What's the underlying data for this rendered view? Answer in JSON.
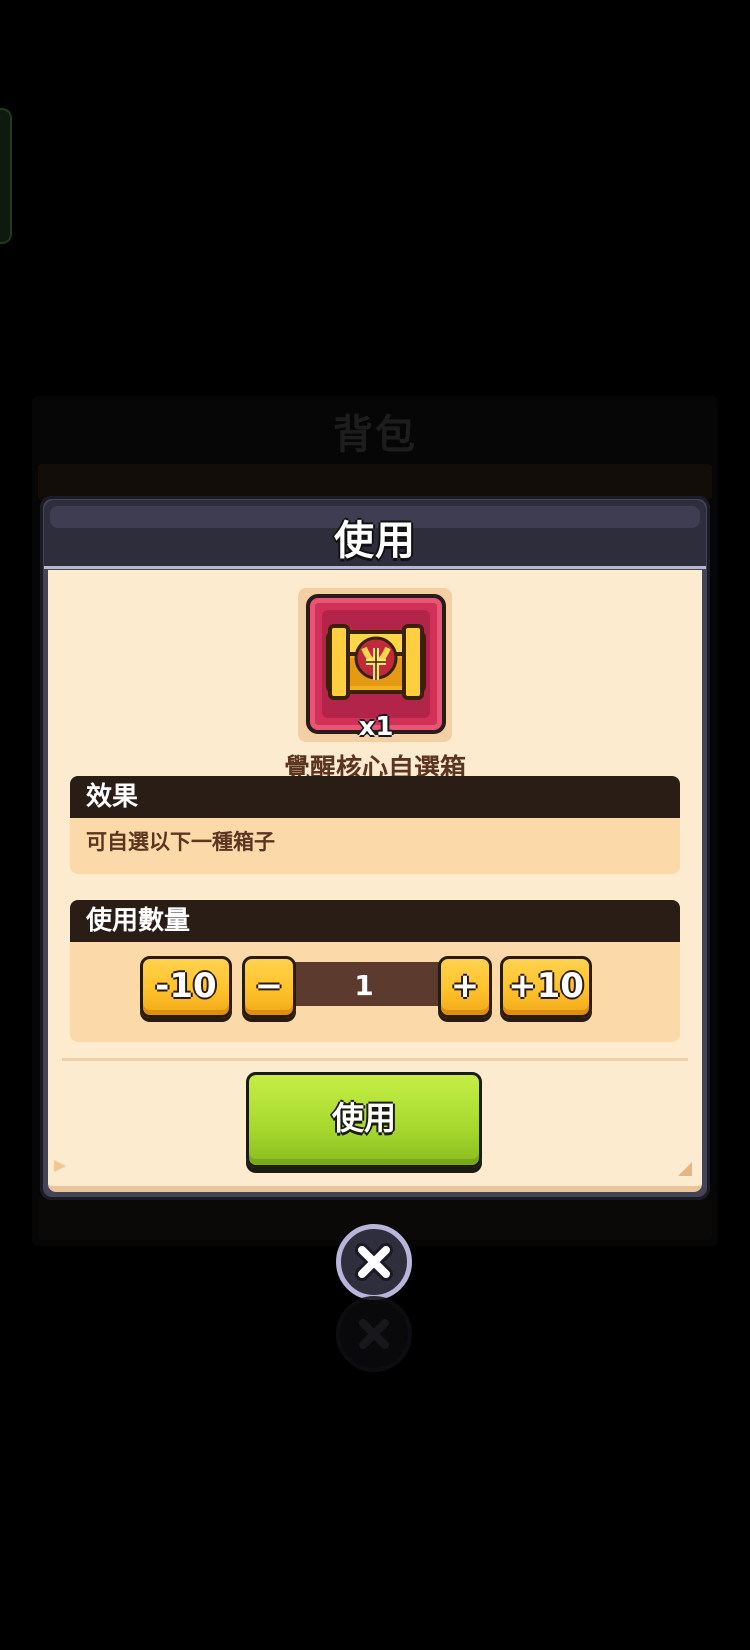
{
  "background": {
    "panel_title": "背包"
  },
  "dialog": {
    "title": "使用",
    "item": {
      "name": "覺醒核心自選箱",
      "count": "x1",
      "icon": "treasure-chest-icon"
    },
    "effect": {
      "header": "效果",
      "text": "可自選以下一種箱子"
    },
    "quantity": {
      "header": "使用數量",
      "minus10_label": "-10",
      "minus1_label": "−",
      "value": "1",
      "plus1_label": "+",
      "plus10_label": "+10"
    },
    "use_button_label": "使用"
  },
  "close_icon": "close-icon",
  "colors": {
    "accent_green": "#a6d82e",
    "accent_yellow": "#ffc22b",
    "item_red": "#d23157",
    "panel_cream": "#fdebcf",
    "header_dark": "#2a1d16"
  }
}
